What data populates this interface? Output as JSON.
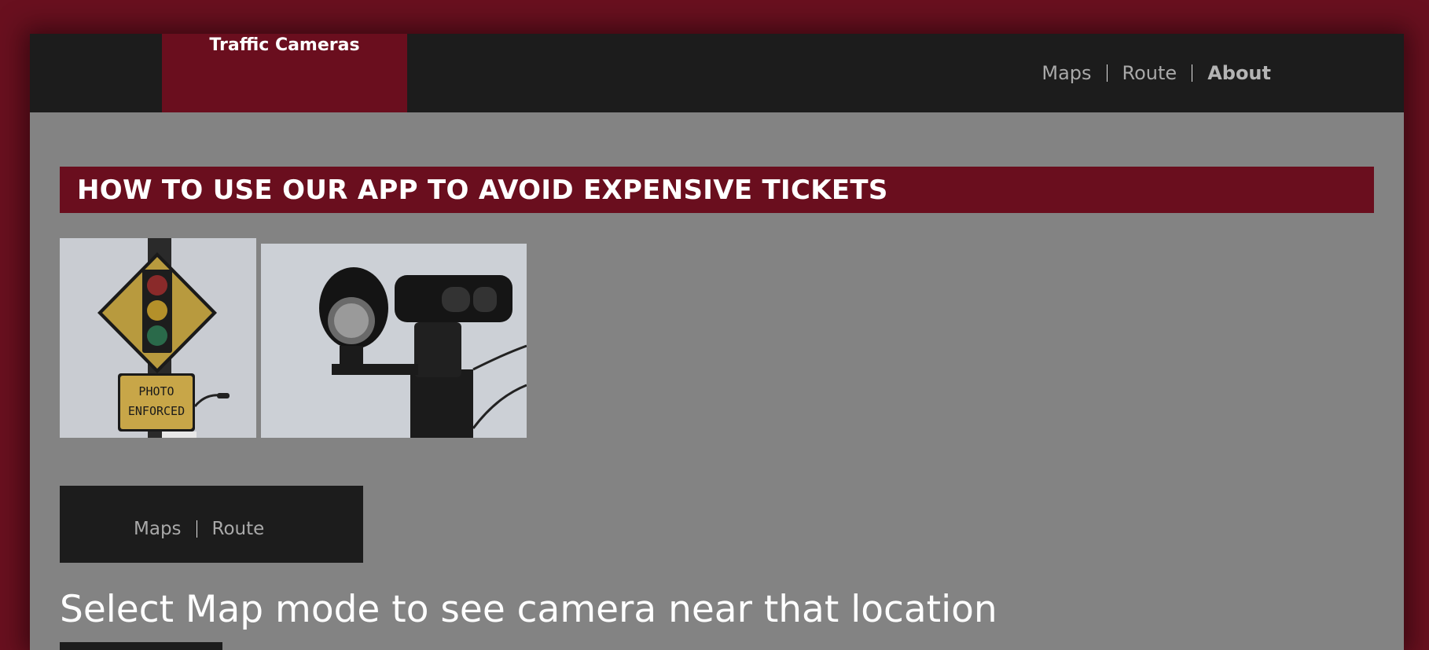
{
  "app": {
    "brand_title": "Traffic Cameras"
  },
  "top_nav": {
    "items": [
      "Maps",
      "Route",
      "About"
    ],
    "active": "About"
  },
  "banner": {
    "heading": "HOW TO USE OUR APP TO AVOID EXPENSIVE TICKETS"
  },
  "photos": {
    "sign": {
      "label_line1": "PHOTO",
      "label_line2": "ENFORCED"
    }
  },
  "sub_nav": {
    "items": [
      "Maps",
      "Route"
    ]
  },
  "main": {
    "headline": "Select Map mode to see camera near that location"
  },
  "colors": {
    "accent": "#6a0e1e",
    "dark": "#1c1c1c",
    "content_bg": "#838383"
  }
}
